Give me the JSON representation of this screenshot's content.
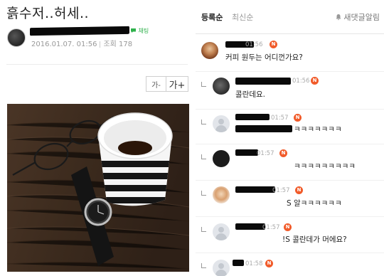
{
  "post": {
    "title": "흙수저..허세..",
    "chat_badge": "채팅",
    "date": "2016.01.07. 01:56",
    "views": "조회 178"
  },
  "font_controls": {
    "small": "가-",
    "large": "가+"
  },
  "comments_header": {
    "tab_registered": "등록순",
    "tab_latest": "최신순",
    "notify": "새댓글알림"
  },
  "comments": [
    {
      "time": "01:56",
      "badge": "N",
      "text": "커피 원두는 어디껀가요?"
    },
    {
      "time": "01:56",
      "badge": "N",
      "text": "콜란데요."
    },
    {
      "time": "01:57",
      "badge": "N",
      "text": "ㅋㅋㅋㅋㅋㅋㅋ"
    },
    {
      "time": "01:57",
      "badge": "N",
      "text": "ㅋㅋㅋㅋㅋㅋㅋㅋㅋ"
    },
    {
      "time": "01:57",
      "badge": "N",
      "text": "S 알ㅋㅋㅋㅋㅋㅋ"
    },
    {
      "time": "01:57",
      "badge": "N",
      "text": "!S 콜란데가 머에요?"
    },
    {
      "time": "01:58",
      "badge": "N",
      "text": ""
    }
  ],
  "colors": {
    "accent_green": "#2fb14c",
    "new_badge": "#f15b2a"
  }
}
